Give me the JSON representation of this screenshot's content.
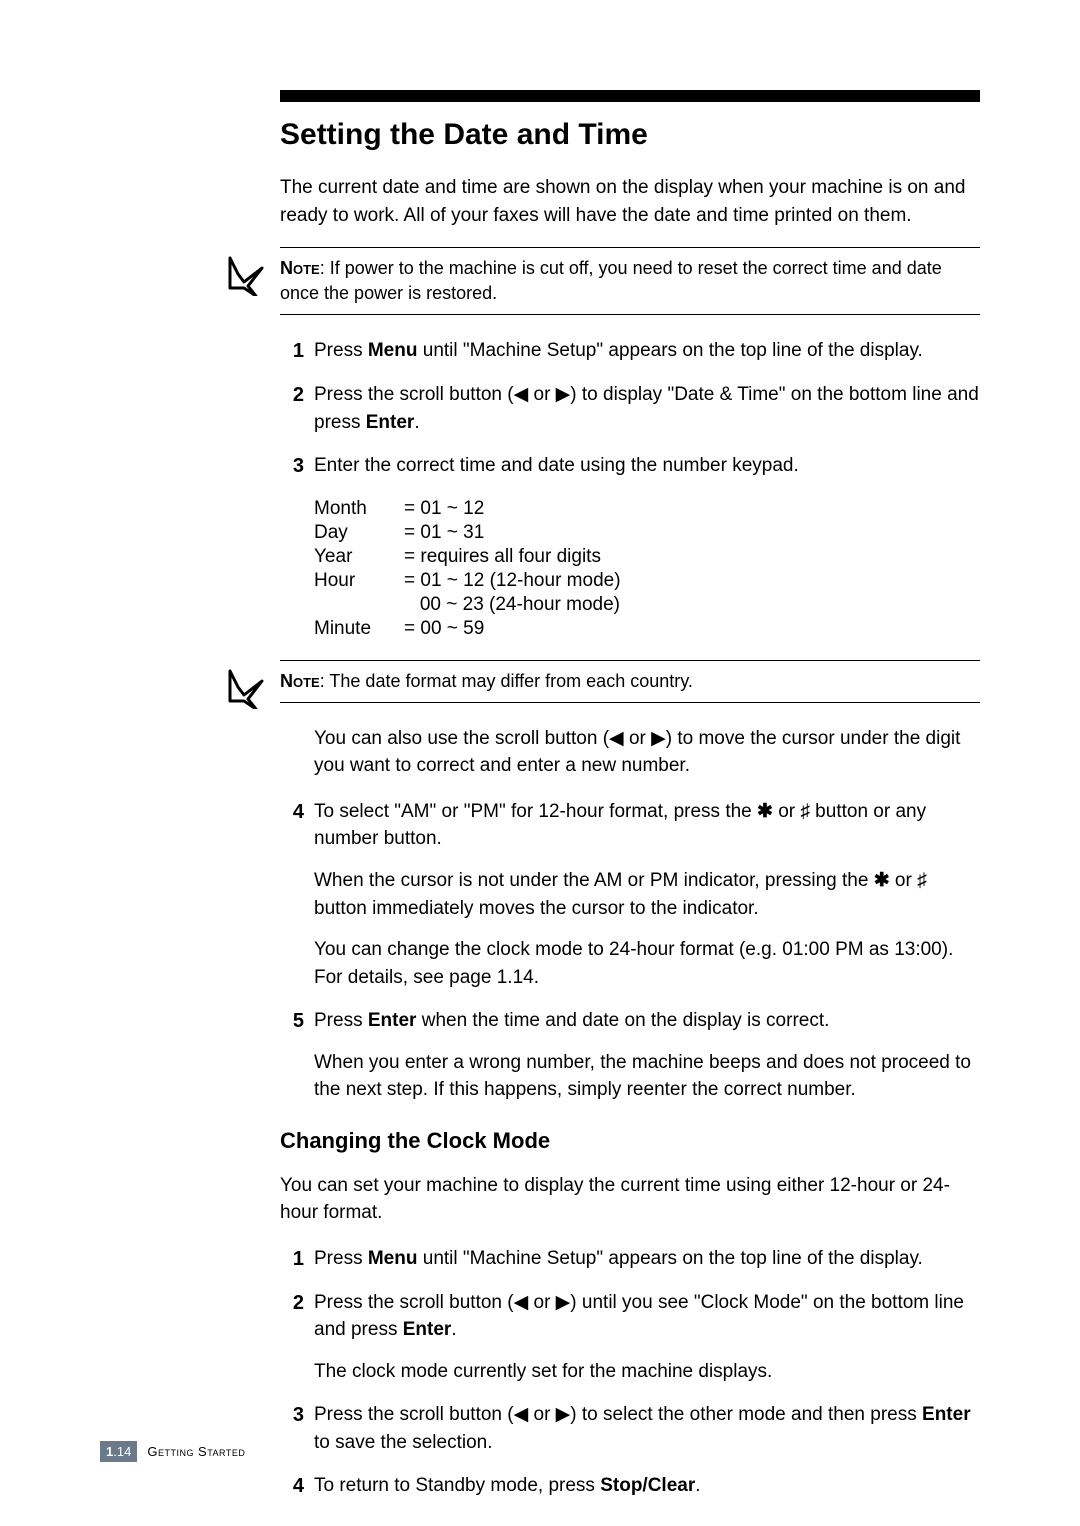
{
  "icons": {
    "noteSvgName": "note-checkmark-icon"
  },
  "title": "Setting the Date and Time",
  "intro": "The current date and time are shown on the display when your machine is on and ready to work. All of your faxes will have the date and time printed on them.",
  "note1": {
    "label": "Note",
    "text": ": If power to the machine is cut off, you need to reset the correct time and date once the power is restored."
  },
  "stepsA": {
    "1": {
      "pre": "Press ",
      "bold": "Menu",
      "post": " until \"Machine Setup\" appears on the top line of the display."
    },
    "2": {
      "pre": "Press the scroll button (",
      "arrowL": "◀",
      "mid": " or ",
      "arrowR": "▶",
      "post1": ") to display \"Date & Time\" on the bottom line and press ",
      "bold": "Enter",
      "post2": "."
    },
    "3": {
      "text": "Enter the correct time and date using the number keypad."
    }
  },
  "table": {
    "rows": [
      {
        "k": "Month",
        "v": "= 01 ~ 12"
      },
      {
        "k": "Day",
        "v": "= 01 ~ 31"
      },
      {
        "k": "Year",
        "v": "= requires all four digits"
      },
      {
        "k": "Hour",
        "v": "= 01 ~ 12 (12-hour mode)"
      },
      {
        "k": "",
        "v": "   00 ~ 23 (24-hour mode)"
      },
      {
        "k": "Minute",
        "v": "= 00 ~ 59"
      }
    ]
  },
  "note2": {
    "label": "Note",
    "text": ": The date format may differ from each country."
  },
  "postNote2": {
    "pre": "You can also use the scroll button (",
    "arrowL": "◀",
    "mid": " or ",
    "arrowR": "▶",
    "post": ") to move the cursor under the digit you want to correct and enter a new number."
  },
  "stepsB": {
    "4": {
      "p1": {
        "pre": "To select \"AM\" or \"PM\" for 12-hour format, press the ",
        "s1": "✱",
        "mid": " or ",
        "s2": "♯",
        "post": " button or any number button."
      },
      "p2": {
        "pre": "When the cursor is not under the AM or PM indicator, pressing the ",
        "s1": "✱",
        "mid": " or ",
        "s2": "♯",
        "post": " button immediately moves the cursor to the indicator."
      },
      "p3": "You can change the clock mode to 24-hour format (e.g. 01:00 PM as 13:00). For details, see page 1.14."
    },
    "5": {
      "p1": {
        "pre": "Press ",
        "bold": "Enter",
        "post": " when the time and date on the display is correct."
      },
      "p2": "When you enter a wrong number, the machine beeps and does not proceed to the next step. If this happens, simply reenter the correct number."
    }
  },
  "sub": {
    "title": "Changing the Clock Mode",
    "intro": "You can set your machine to display the current time using either 12-hour or 24-hour format.",
    "steps": {
      "1": {
        "pre": "Press ",
        "bold": "Menu",
        "post": " until \"Machine Setup\" appears on the top line of the display."
      },
      "2": {
        "p1": {
          "pre": "Press the scroll button (",
          "arrowL": "◀",
          "mid": " or ",
          "arrowR": "▶",
          "post1": ") until you see \"Clock Mode\" on the bottom line and press ",
          "bold": "Enter",
          "post2": "."
        },
        "p2": "The clock mode currently set for the machine displays."
      },
      "3": {
        "pre": "Press the scroll button (",
        "arrowL": "◀",
        "mid": " or ",
        "arrowR": "▶",
        "post1": ") to select the other mode and then press ",
        "bold": "Enter",
        "post2": " to save the selection."
      },
      "4": {
        "pre": "To return to Standby mode, press ",
        "bold": "Stop/Clear",
        "post": "."
      }
    }
  },
  "footer": {
    "num1": "1",
    "dot": ".",
    "num2": "14",
    "chapter": "Getting Started"
  }
}
